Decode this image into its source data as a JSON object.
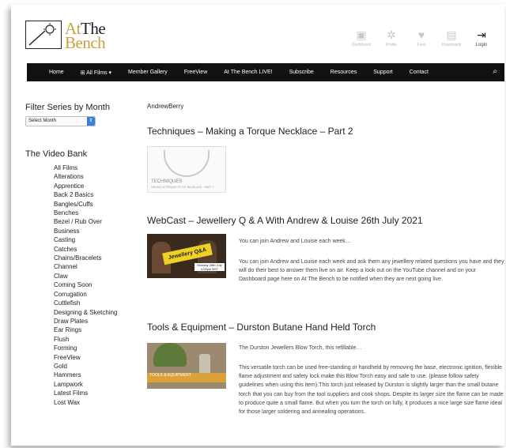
{
  "logo": {
    "line1_prefix": "At",
    "line1_suffix": "The",
    "line2": "Bench"
  },
  "header_icons": [
    {
      "name": "dashboard-icon",
      "glyph": "▣",
      "label": "Dashboard"
    },
    {
      "name": "settings-icon",
      "glyph": "✲",
      "label": "Profile"
    },
    {
      "name": "heart-icon",
      "glyph": "♥",
      "label": "Favs"
    },
    {
      "name": "document-icon",
      "glyph": "▤",
      "label": "Downloads"
    },
    {
      "name": "login-icon",
      "glyph": "⇥",
      "label": "Login"
    }
  ],
  "nav": {
    "items": [
      "Home",
      "⊞ All Films ▾",
      "Member Gallery",
      "FreeView",
      "At The Bench LIVE!",
      "Subscribe",
      "Resources",
      "Support",
      "Contact"
    ],
    "search_icon": "⌕"
  },
  "sidebar": {
    "filter_heading": "Filter Series by Month",
    "select_value": "Select Month",
    "video_bank_heading": "The Video Bank",
    "items": [
      "All Films",
      "Alterations",
      "Apprentice",
      "Back 2 Basics",
      "Bangles/Cuffs",
      "Benches",
      "Bezel / Rub Over",
      "Business",
      "Casting",
      "Catches",
      "Chains/Bracelets",
      "Channel",
      "Claw",
      "Coming Soon",
      "Corrugation",
      "Cuttlefish",
      "Designing & Sketching",
      "Draw Plates",
      "Ear Rings",
      "Flush",
      "Forming",
      "FreeView",
      "Gold",
      "Hammers",
      "Lampwork",
      "Latest Films",
      "Lost Wax"
    ]
  },
  "main": {
    "author": "AndrewBerry",
    "posts": [
      {
        "title": "Techniques – Making a Torque Necklace – Part 2",
        "thumb_caption": "TECHNIQUES",
        "thumb_subcaption": "MAKING A TORQUE STYLE NECKLACE - PART 2"
      },
      {
        "title": "WebCast – Jewellery Q & A With Andrew & Louise 26th July 2021",
        "thumb_text": "Jewellery Q&A",
        "thumb_date": "Monday 26th July 4:00pm BST",
        "excerpt_short": "You can join Andrew and Louise each week…",
        "excerpt_long": "You can join Andrew and Louise each week and ask them any jewellery related questions you have and they will do their best to answer them live on air. Keep a look out on the YouTube channel and on your Dashboard page here on At The Bench to be notified when they are next going live."
      },
      {
        "title": "Tools & Equipment – Durston Butane Hand Held Torch",
        "thumb_text": "TOOLS & EQUIPMENT",
        "excerpt_short": "The Durston Jewellers Blow Torch, this refillable…",
        "excerpt_long": "This versatile torch can be used free-standing or handheld by removing the base, electronic ignition, flexible flame adjustment and safety lock make this Blow Torch easy and safe to use. (please follow safety guidelines when using this item).This torch just released by Durston is slightly larger than the small butane torch that you can buy from the tool suppliers and cook shops. Despite its larger size the flame can be made to produce quite a small flame. But when you turn the torch on fully, it produces a nice large size flame ideal for those larger soldering and annealing operations."
      }
    ]
  }
}
